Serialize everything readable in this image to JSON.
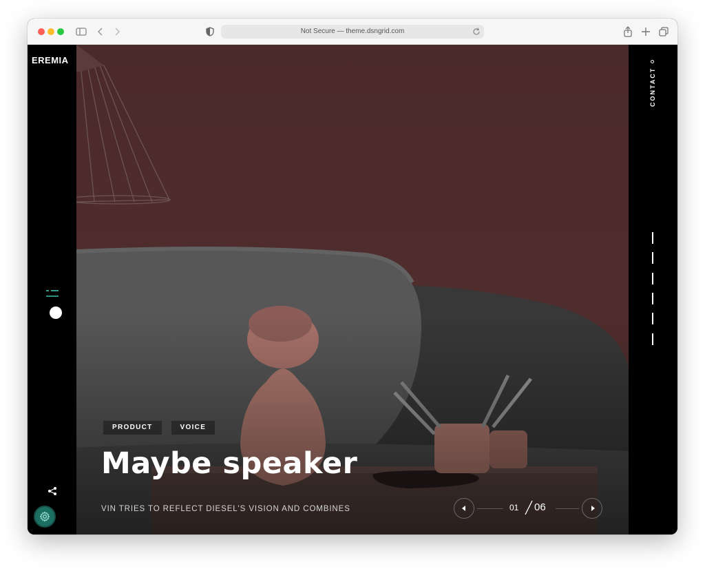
{
  "browser": {
    "address": "Not Secure — theme.dsngrid.com"
  },
  "sidebar": {
    "logo": "EREMIA",
    "icons": [
      "menu-icon",
      "share-icon",
      "settings-icon"
    ]
  },
  "right_rail": {
    "contact_label": "CONTACT",
    "slide_count_marks": 6
  },
  "hero": {
    "tags": [
      "PRODUCT",
      "VOICE"
    ],
    "title": "Maybe speaker",
    "subtitle": "VIN TRIES TO REFLECT DIESEL'S VISION AND COMBINES",
    "pager": {
      "current": "01",
      "total": "06"
    }
  },
  "colors": {
    "wall": "#4f2c2c",
    "sofa": "#585858",
    "speaker": "#b77f74",
    "settings_button": "#1c6f63"
  }
}
